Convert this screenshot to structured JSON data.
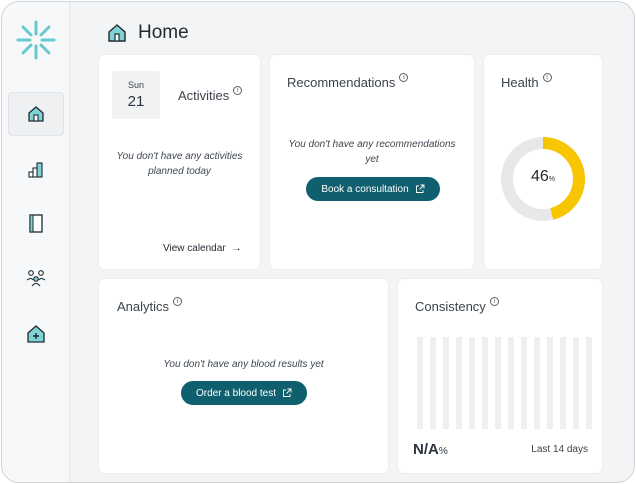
{
  "header": {
    "title": "Home"
  },
  "sidebar": {
    "items": [
      "home-icon",
      "buildings-icon",
      "notebook-icon",
      "people-icon",
      "add-clinic-icon"
    ]
  },
  "activities": {
    "day": "Sun",
    "date": "21",
    "title": "Activities",
    "empty_text": "You don't have any activities planned today",
    "link": "View calendar",
    "link_arrow": "→"
  },
  "recommendations": {
    "title": "Recommendations",
    "empty_text": "You don't have any recommendations yet",
    "button": "Book a consultation"
  },
  "health": {
    "title": "Health",
    "score": "46",
    "unit": "%",
    "score_fraction": 0.46,
    "accent": "#f7c600",
    "track": "#e6e8ea"
  },
  "analytics": {
    "title": "Analytics",
    "empty_text": "You don't have any blood results yet",
    "button": "Order a blood test"
  },
  "consistency": {
    "title": "Consistency",
    "value": "N/A",
    "unit": "%",
    "period": "Last 14 days"
  },
  "colors": {
    "brand": "#0f5f6e",
    "brand_light": "#7fd3d3"
  }
}
